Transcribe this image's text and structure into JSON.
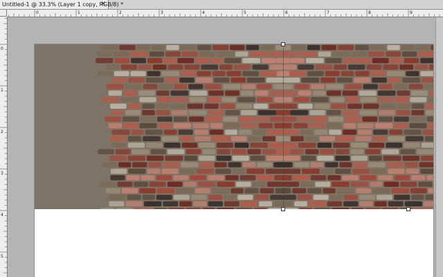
{
  "document_tab": {
    "title": "Untitled-1 @ 33.3% (Layer 1 copy, RGB/8) *",
    "close_glyph": "✕"
  },
  "rulers": {
    "top_ticks": [
      "0",
      "1",
      "2",
      "3",
      "4",
      "5",
      "6",
      "7",
      "8",
      "9"
    ],
    "left_ticks": [
      "0",
      "1",
      "2",
      "3",
      "4",
      "5"
    ]
  },
  "canvas": {
    "background": "#ffffff",
    "layer_name": "Layer 1 copy",
    "texture_colors": [
      "#8b3a2c",
      "#a2493a",
      "#6e2c22",
      "#b45a48",
      "#7a6a55",
      "#9a8d78",
      "#5a4a3c",
      "#c08070",
      "#3a2e2a",
      "#b9b2a2"
    ]
  }
}
